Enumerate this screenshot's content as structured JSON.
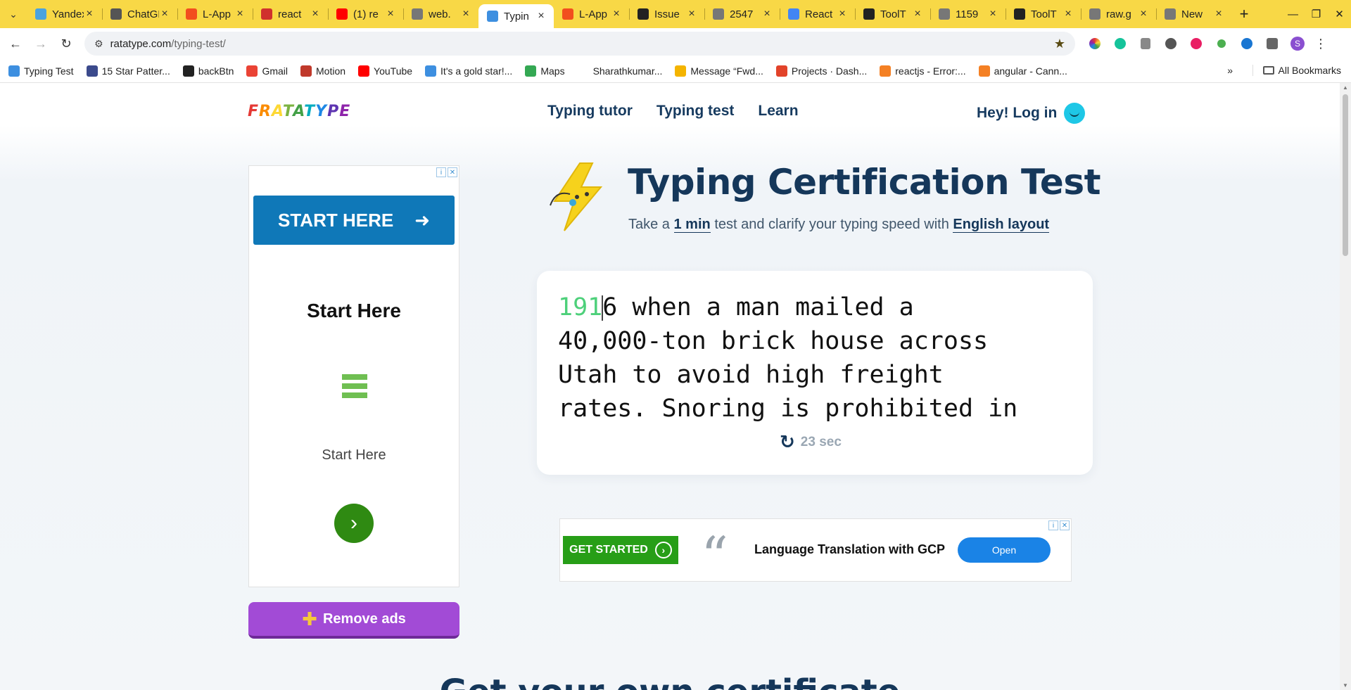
{
  "browser": {
    "tabs": [
      {
        "label": "Yandex",
        "icon": "yandex-icon",
        "color": "#4aa3df"
      },
      {
        "label": "ChatGPT",
        "icon": "chatgpt-icon",
        "color": "#555555"
      },
      {
        "label": "L-App",
        "icon": "figma-icon",
        "color": "#f24e1e"
      },
      {
        "label": "react",
        "icon": "react-icon",
        "color": "#d0312d"
      },
      {
        "label": "(1) re",
        "icon": "youtube-icon",
        "color": "#ff0000"
      },
      {
        "label": "web.",
        "icon": "globe-icon",
        "color": "#777777"
      },
      {
        "label": "Typin",
        "icon": "ratatype-icon",
        "color": "#3d8fe0",
        "active": true
      },
      {
        "label": "L-App",
        "icon": "figma-icon",
        "color": "#f24e1e"
      },
      {
        "label": "Issue",
        "icon": "github-icon",
        "color": "#222222"
      },
      {
        "label": "2547",
        "icon": "globe-icon",
        "color": "#777777"
      },
      {
        "label": "React",
        "icon": "google-icon",
        "color": "#4285f4"
      },
      {
        "label": "ToolT",
        "icon": "github-icon",
        "color": "#222222"
      },
      {
        "label": "1159",
        "icon": "globe-icon",
        "color": "#777777"
      },
      {
        "label": "ToolT",
        "icon": "github-icon",
        "color": "#222222"
      },
      {
        "label": "raw.g",
        "icon": "globe-icon",
        "color": "#777777"
      },
      {
        "label": "New",
        "icon": "chrome-icon",
        "color": "#777777"
      }
    ],
    "url_domain": "ratatype.com",
    "url_path": "/typing-test/",
    "profile_initial": "S",
    "bookmarks": [
      {
        "label": "Typing Test",
        "color": "#3d8fe0"
      },
      {
        "label": "15 Star Patter...",
        "color": "#3b4a8c"
      },
      {
        "label": "backBtn",
        "color": "#222222"
      },
      {
        "label": "Gmail",
        "color": "#ea4335"
      },
      {
        "label": "Motion",
        "color": "#c0392b"
      },
      {
        "label": "YouTube",
        "color": "#ff0000"
      },
      {
        "label": "It's a gold star!...",
        "color": "#3d8fe0"
      },
      {
        "label": "Maps",
        "color": "#34a853"
      },
      {
        "label": "Sharathkumar...",
        "color": "#ffffff"
      },
      {
        "label": "Message “Fwd...",
        "color": "#f4b400"
      },
      {
        "label": "Projects · Dash...",
        "color": "#e2432a"
      },
      {
        "label": "reactjs - Error:...",
        "color": "#f48024"
      },
      {
        "label": "angular - Cann...",
        "color": "#f48024"
      }
    ],
    "all_bookmarks": "All Bookmarks"
  },
  "site": {
    "logo": "FRATATYPE",
    "nav": [
      "Typing tutor",
      "Typing test",
      "Learn"
    ],
    "login": "Hey! Log in"
  },
  "hero": {
    "title": "Typing Certification Test",
    "sub_prefix": "Take a",
    "sub_duration": "1 min",
    "sub_middle": "test and clarify your typing speed with",
    "sub_layout": "English layout"
  },
  "typing": {
    "typed": "191",
    "line1_rest": "6 when a man mailed a",
    "lines": [
      "40,000-ton brick house across",
      "Utah to avoid high freight",
      "rates. Snoring is prohibited in"
    ],
    "timer": "23 sec"
  },
  "ad_left": {
    "cta": "START HERE",
    "title": "Start Here",
    "subtitle": "Start Here"
  },
  "remove_ads": "Remove ads",
  "ad_bottom": {
    "cta": "GET STARTED",
    "headline": "Language Translation with GCP",
    "button": "Open"
  },
  "cert_heading": "Get your own certificate"
}
